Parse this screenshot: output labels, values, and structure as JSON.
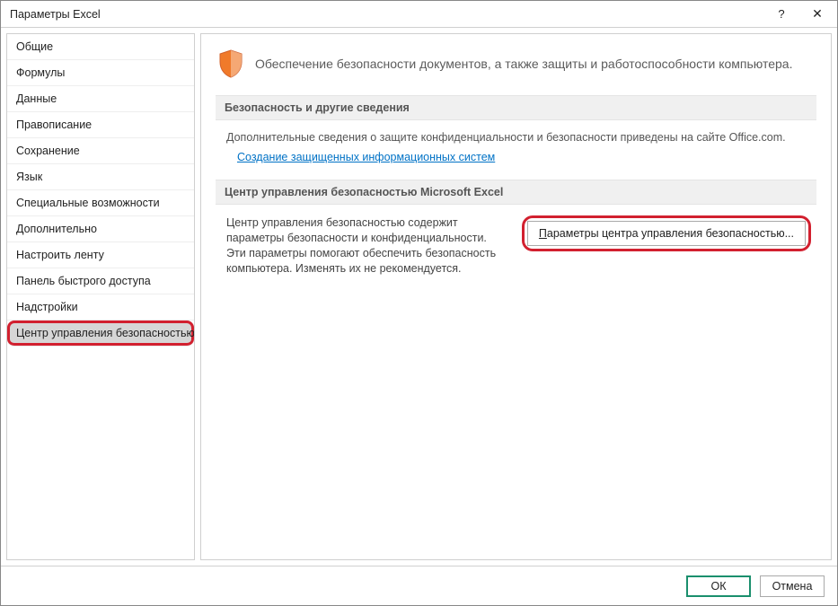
{
  "title": "Параметры Excel",
  "sidebar": {
    "items": [
      {
        "label": "Общие"
      },
      {
        "label": "Формулы"
      },
      {
        "label": "Данные"
      },
      {
        "label": "Правописание"
      },
      {
        "label": "Сохранение"
      },
      {
        "label": "Язык"
      },
      {
        "label": "Специальные возможности"
      },
      {
        "label": "Дополнительно"
      },
      {
        "label": "Настроить ленту"
      },
      {
        "label": "Панель быстрого доступа"
      },
      {
        "label": "Надстройки"
      },
      {
        "label": "Центр управления безопасностью"
      }
    ]
  },
  "intro": {
    "text": "Обеспечение безопасности документов, а также защиты и работоспособности компьютера."
  },
  "section1": {
    "header": "Безопасность и другие сведения",
    "desc": "Дополнительные сведения о защите конфиденциальности и безопасности приведены на сайте Office.com.",
    "link": "Создание защищенных информационных систем"
  },
  "section2": {
    "header": "Центр управления безопасностью Microsoft Excel",
    "desc": "Центр управления безопасностью содержит параметры безопасности и конфиденциальности. Эти параметры помогают обеспечить безопасность компьютера. Изменять их не рекомендуется.",
    "button_prefix": "П",
    "button_rest": "араметры центра управления безопасностью..."
  },
  "footer": {
    "ok": "ОК",
    "cancel": "Отмена"
  }
}
